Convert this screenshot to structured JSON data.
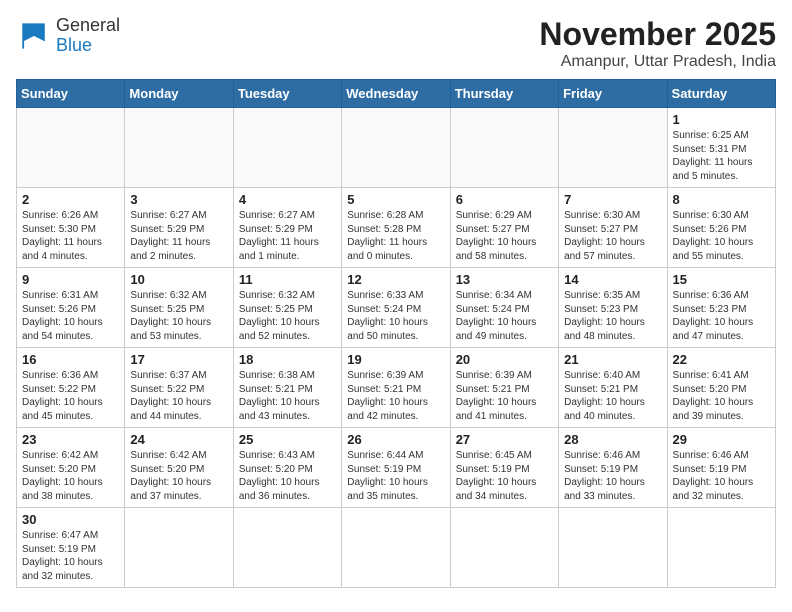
{
  "header": {
    "logo_general": "General",
    "logo_blue": "Blue",
    "title": "November 2025",
    "subtitle": "Amanpur, Uttar Pradesh, India"
  },
  "weekdays": [
    "Sunday",
    "Monday",
    "Tuesday",
    "Wednesday",
    "Thursday",
    "Friday",
    "Saturday"
  ],
  "weeks": [
    [
      {
        "day": "",
        "info": ""
      },
      {
        "day": "",
        "info": ""
      },
      {
        "day": "",
        "info": ""
      },
      {
        "day": "",
        "info": ""
      },
      {
        "day": "",
        "info": ""
      },
      {
        "day": "",
        "info": ""
      },
      {
        "day": "1",
        "info": "Sunrise: 6:25 AM\nSunset: 5:31 PM\nDaylight: 11 hours and 5 minutes."
      }
    ],
    [
      {
        "day": "2",
        "info": "Sunrise: 6:26 AM\nSunset: 5:30 PM\nDaylight: 11 hours and 4 minutes."
      },
      {
        "day": "3",
        "info": "Sunrise: 6:27 AM\nSunset: 5:29 PM\nDaylight: 11 hours and 2 minutes."
      },
      {
        "day": "4",
        "info": "Sunrise: 6:27 AM\nSunset: 5:29 PM\nDaylight: 11 hours and 1 minute."
      },
      {
        "day": "5",
        "info": "Sunrise: 6:28 AM\nSunset: 5:28 PM\nDaylight: 11 hours and 0 minutes."
      },
      {
        "day": "6",
        "info": "Sunrise: 6:29 AM\nSunset: 5:27 PM\nDaylight: 10 hours and 58 minutes."
      },
      {
        "day": "7",
        "info": "Sunrise: 6:30 AM\nSunset: 5:27 PM\nDaylight: 10 hours and 57 minutes."
      },
      {
        "day": "8",
        "info": "Sunrise: 6:30 AM\nSunset: 5:26 PM\nDaylight: 10 hours and 55 minutes."
      }
    ],
    [
      {
        "day": "9",
        "info": "Sunrise: 6:31 AM\nSunset: 5:26 PM\nDaylight: 10 hours and 54 minutes."
      },
      {
        "day": "10",
        "info": "Sunrise: 6:32 AM\nSunset: 5:25 PM\nDaylight: 10 hours and 53 minutes."
      },
      {
        "day": "11",
        "info": "Sunrise: 6:32 AM\nSunset: 5:25 PM\nDaylight: 10 hours and 52 minutes."
      },
      {
        "day": "12",
        "info": "Sunrise: 6:33 AM\nSunset: 5:24 PM\nDaylight: 10 hours and 50 minutes."
      },
      {
        "day": "13",
        "info": "Sunrise: 6:34 AM\nSunset: 5:24 PM\nDaylight: 10 hours and 49 minutes."
      },
      {
        "day": "14",
        "info": "Sunrise: 6:35 AM\nSunset: 5:23 PM\nDaylight: 10 hours and 48 minutes."
      },
      {
        "day": "15",
        "info": "Sunrise: 6:36 AM\nSunset: 5:23 PM\nDaylight: 10 hours and 47 minutes."
      }
    ],
    [
      {
        "day": "16",
        "info": "Sunrise: 6:36 AM\nSunset: 5:22 PM\nDaylight: 10 hours and 45 minutes."
      },
      {
        "day": "17",
        "info": "Sunrise: 6:37 AM\nSunset: 5:22 PM\nDaylight: 10 hours and 44 minutes."
      },
      {
        "day": "18",
        "info": "Sunrise: 6:38 AM\nSunset: 5:21 PM\nDaylight: 10 hours and 43 minutes."
      },
      {
        "day": "19",
        "info": "Sunrise: 6:39 AM\nSunset: 5:21 PM\nDaylight: 10 hours and 42 minutes."
      },
      {
        "day": "20",
        "info": "Sunrise: 6:39 AM\nSunset: 5:21 PM\nDaylight: 10 hours and 41 minutes."
      },
      {
        "day": "21",
        "info": "Sunrise: 6:40 AM\nSunset: 5:21 PM\nDaylight: 10 hours and 40 minutes."
      },
      {
        "day": "22",
        "info": "Sunrise: 6:41 AM\nSunset: 5:20 PM\nDaylight: 10 hours and 39 minutes."
      }
    ],
    [
      {
        "day": "23",
        "info": "Sunrise: 6:42 AM\nSunset: 5:20 PM\nDaylight: 10 hours and 38 minutes."
      },
      {
        "day": "24",
        "info": "Sunrise: 6:42 AM\nSunset: 5:20 PM\nDaylight: 10 hours and 37 minutes."
      },
      {
        "day": "25",
        "info": "Sunrise: 6:43 AM\nSunset: 5:20 PM\nDaylight: 10 hours and 36 minutes."
      },
      {
        "day": "26",
        "info": "Sunrise: 6:44 AM\nSunset: 5:19 PM\nDaylight: 10 hours and 35 minutes."
      },
      {
        "day": "27",
        "info": "Sunrise: 6:45 AM\nSunset: 5:19 PM\nDaylight: 10 hours and 34 minutes."
      },
      {
        "day": "28",
        "info": "Sunrise: 6:46 AM\nSunset: 5:19 PM\nDaylight: 10 hours and 33 minutes."
      },
      {
        "day": "29",
        "info": "Sunrise: 6:46 AM\nSunset: 5:19 PM\nDaylight: 10 hours and 32 minutes."
      }
    ],
    [
      {
        "day": "30",
        "info": "Sunrise: 6:47 AM\nSunset: 5:19 PM\nDaylight: 10 hours and 32 minutes."
      },
      {
        "day": "",
        "info": ""
      },
      {
        "day": "",
        "info": ""
      },
      {
        "day": "",
        "info": ""
      },
      {
        "day": "",
        "info": ""
      },
      {
        "day": "",
        "info": ""
      },
      {
        "day": "",
        "info": ""
      }
    ]
  ]
}
